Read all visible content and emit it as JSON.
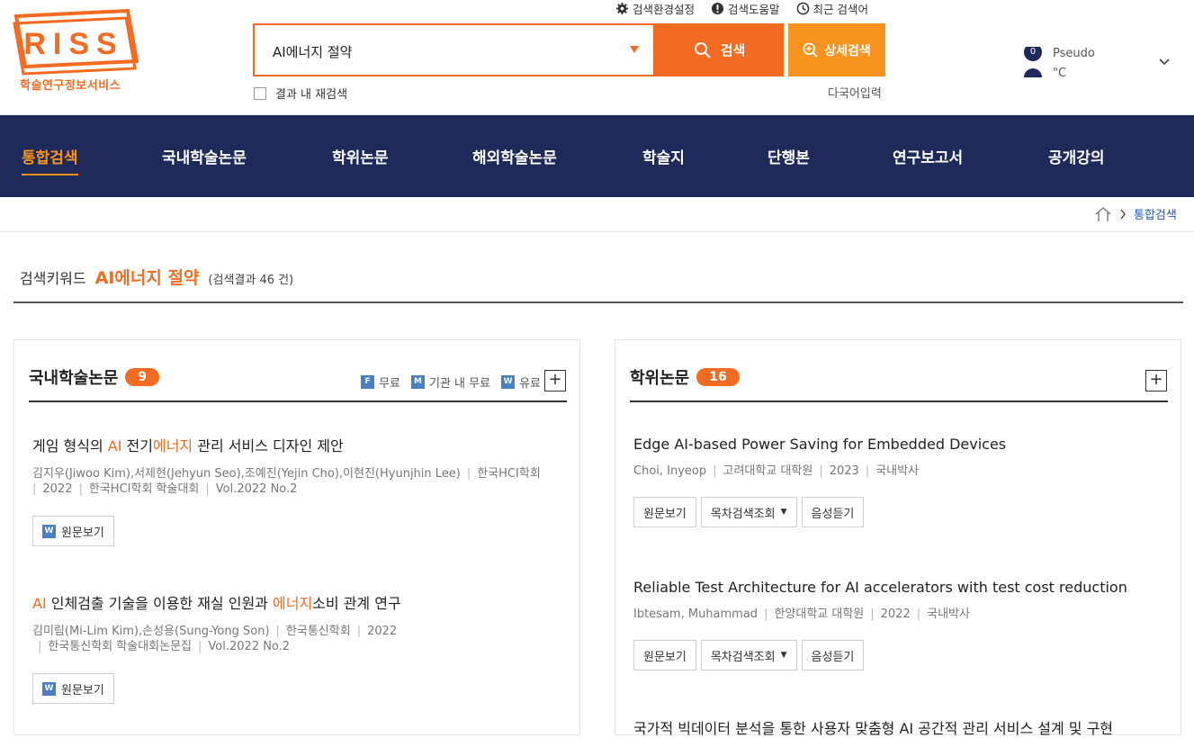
{
  "brand": {
    "logo_text": "RISS",
    "subtitle": "학술연구정보서비스",
    "color": "#f26b21",
    "nav_color": "#1e2a5a"
  },
  "top_links": [
    {
      "icon": "gear-icon",
      "label": "검색환경설정"
    },
    {
      "icon": "info-icon",
      "label": "검색도움말"
    },
    {
      "icon": "clock-icon",
      "label": "최근 검색어"
    }
  ],
  "search": {
    "value": "AI에너지 절약",
    "button_label": "검색",
    "detail_label": "상세검색",
    "research_label": "결과 내 재검색",
    "multilang_label": "다국어입력"
  },
  "user": {
    "badge": "0",
    "line1": "Pseudo",
    "line2": "\"C"
  },
  "nav": {
    "items": [
      "통합검색",
      "국내학술논문",
      "학위논문",
      "해외학술논문",
      "학술지",
      "단행본",
      "연구보고서",
      "공개강의"
    ],
    "active": "통합검색"
  },
  "breadcrumb": {
    "current": "통합검색"
  },
  "keyword": {
    "label": "검색키워드",
    "term": "AI에너지 절약",
    "count_text": "(검색결과 46 건)"
  },
  "domestic": {
    "title": "국내학술논문",
    "count": "9",
    "legend": [
      {
        "icon": "F",
        "label": "무료"
      },
      {
        "icon": "M",
        "label": "기관 내 무료"
      },
      {
        "icon": "W",
        "label": "유료"
      }
    ],
    "results": [
      {
        "title_parts": [
          {
            "text": "게임 형식의 ",
            "hl": false
          },
          {
            "text": "AI",
            "hl": true
          },
          {
            "text": " 전기",
            "hl": false
          },
          {
            "text": "에너지",
            "hl": true
          },
          {
            "text": " 관리 서비스 디자인 제안",
            "hl": false
          }
        ],
        "meta_line1": [
          "김지우(Jiwoo Kim),서제현(Jehyun Seo),조예진(Yejin Cho),이현진(Hyunjhin Lee)",
          "한국HCI학회"
        ],
        "meta_line2": [
          "2022",
          "한국HCI학회 학술대회",
          "Vol.2022 No.2"
        ],
        "button": "원문보기"
      },
      {
        "title_parts": [
          {
            "text": "AI",
            "hl": true
          },
          {
            "text": " 인체검출 기술을 이용한 재실 인원과 ",
            "hl": false
          },
          {
            "text": "에너지",
            "hl": true
          },
          {
            "text": "소비 관계 연구",
            "hl": false
          }
        ],
        "meta_line1": [
          "김미림(Mi-Lim Kim),손성용(Sung-Yong Son)",
          "한국통신학회",
          "2022"
        ],
        "meta_line2": [
          "한국통신학회 학술대회논문집",
          "Vol.2022 No.2"
        ],
        "button": "원문보기"
      }
    ]
  },
  "thesis": {
    "title": "학위논문",
    "count": "16",
    "results": [
      {
        "title": "Edge AI-based Power Saving for Embedded Devices",
        "meta": [
          "Choi, Inyeop",
          "고려대학교 대학원",
          "2023",
          "국내박사"
        ],
        "buttons": [
          "원문보기",
          "목차검색조회",
          "음성듣기"
        ]
      },
      {
        "title": "Reliable Test Architecture for AI accelerators with test cost reduction",
        "meta": [
          "Ibtesam, Muhammad",
          "한양대학교 대학원",
          "2022",
          "국내박사"
        ],
        "buttons": [
          "원문보기",
          "목차검색조회",
          "음성듣기"
        ]
      }
    ],
    "partial_title": "국가적 빅데이터 분석을 통한 사용자 맞춤형 AI 공간적 관리 서비스 설계 및 구현"
  }
}
